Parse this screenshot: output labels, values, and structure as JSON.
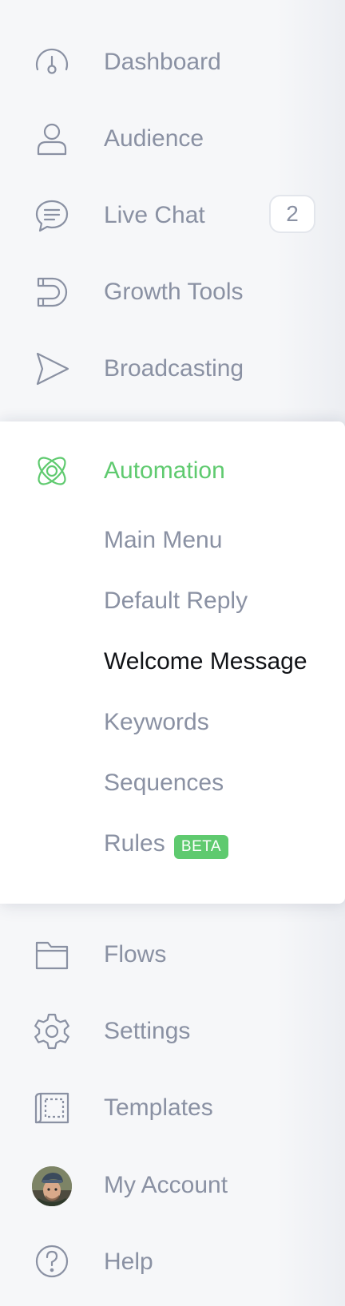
{
  "nav": {
    "dashboard": {
      "label": "Dashboard",
      "icon": "gauge-icon"
    },
    "audience": {
      "label": "Audience",
      "icon": "user-icon"
    },
    "live_chat": {
      "label": "Live Chat",
      "icon": "chat-bubble-icon",
      "badge": "2"
    },
    "growth_tools": {
      "label": "Growth Tools",
      "icon": "magnet-icon"
    },
    "broadcasting": {
      "label": "Broadcasting",
      "icon": "send-icon"
    },
    "automation": {
      "label": "Automation",
      "icon": "atom-icon",
      "color": "#5fca6f",
      "items": [
        {
          "label": "Main Menu"
        },
        {
          "label": "Default Reply"
        },
        {
          "label": "Welcome Message",
          "active": true
        },
        {
          "label": "Keywords"
        },
        {
          "label": "Sequences"
        },
        {
          "label": "Rules",
          "badge": "BETA"
        }
      ]
    },
    "flows": {
      "label": "Flows",
      "icon": "folder-icon"
    },
    "settings": {
      "label": "Settings",
      "icon": "gear-icon"
    },
    "templates": {
      "label": "Templates",
      "icon": "blueprint-icon"
    },
    "my_account": {
      "label": "My Account",
      "icon": "avatar"
    },
    "help": {
      "label": "Help",
      "icon": "help-icon"
    }
  },
  "colors": {
    "text_muted": "#8a91a3",
    "text_active": "#111317",
    "accent_green": "#5fca6f",
    "background": "#f6f7f9",
    "panel": "#ffffff"
  }
}
